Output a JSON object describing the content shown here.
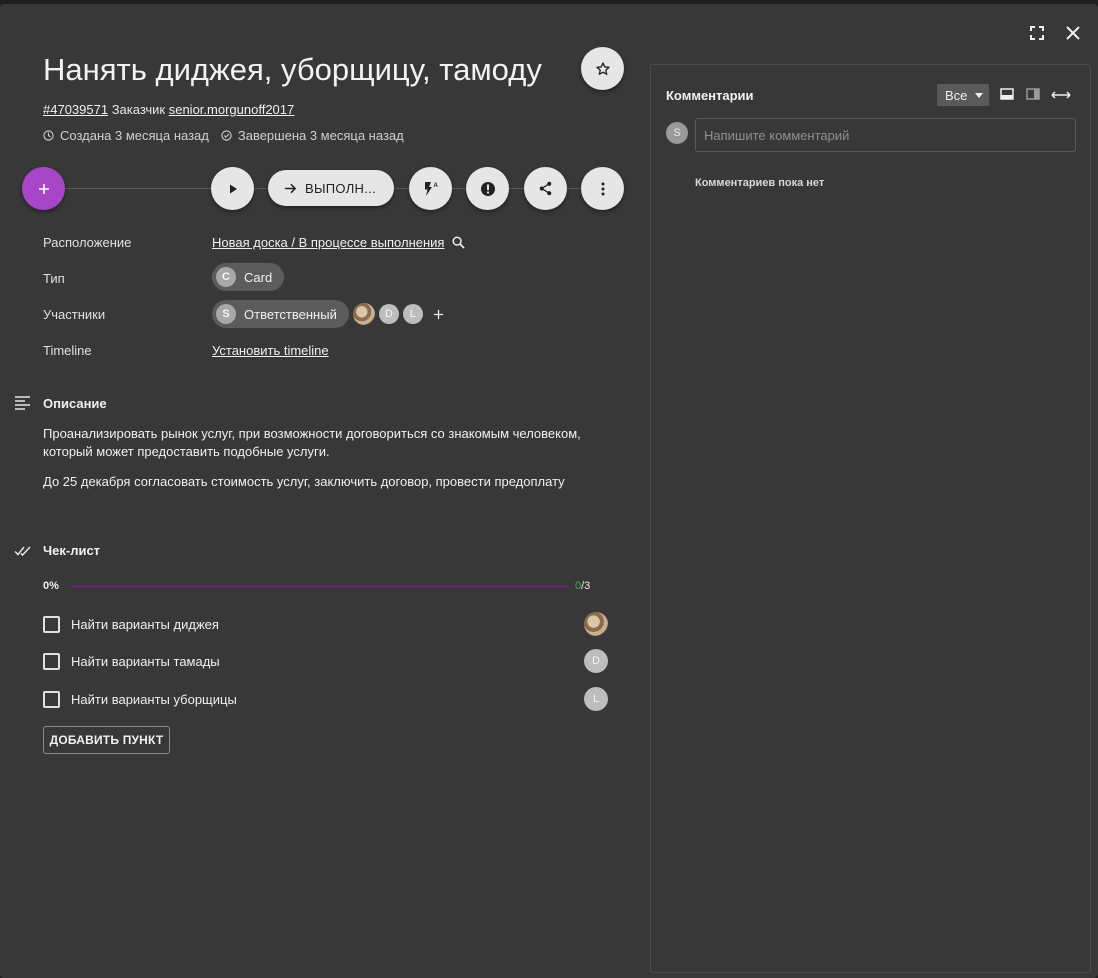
{
  "card": {
    "title": "Нанять диджея, уборщицу, тамоду",
    "id": "#47039571",
    "customer_label": "Заказчик",
    "customer": "senior.morgunoff2017",
    "created": "Создана 3 месяца назад",
    "completed": "Завершена 3 месяца назад"
  },
  "toolbar": {
    "status_label": "ВЫПОЛН...",
    "add_icon": "plus-icon",
    "accent_color": "#a846c8"
  },
  "properties": {
    "location_label": "Расположение",
    "location_value": "Новая доска / В процессе выполнения",
    "type_label": "Тип",
    "type_initial": "C",
    "type_value": "Card",
    "members_label": "Участники",
    "responsible_initial": "S",
    "responsible_value": "Ответственный",
    "member_d": "D",
    "member_l": "L",
    "timeline_label": "Timeline",
    "timeline_value": "Установить timeline"
  },
  "description": {
    "heading": "Описание",
    "paragraph1": "Проанализировать рынок услуг, при возможности договориться со знакомым человеком, который может предоставить подобные услуги.",
    "paragraph2": "До 25 декабря согласовать стоимость услуг, заключить договор, провести предоплату"
  },
  "checklist": {
    "heading": "Чек-лист",
    "percent": "0%",
    "done": "0",
    "total": "/3",
    "progress_fraction": 0,
    "items": [
      {
        "label": "Найти варианты диджея",
        "assignee": ""
      },
      {
        "label": "Найти варианты тамады",
        "assignee": "D"
      },
      {
        "label": "Найти варианты уборщицы",
        "assignee": "L"
      }
    ],
    "add_button": "ДОБАВИТЬ ПУНКТ"
  },
  "comments": {
    "title": "Комментарии",
    "filter": "Все",
    "user_initial": "S",
    "placeholder": "Напишите комментарий",
    "empty": "Комментариев пока нет"
  }
}
